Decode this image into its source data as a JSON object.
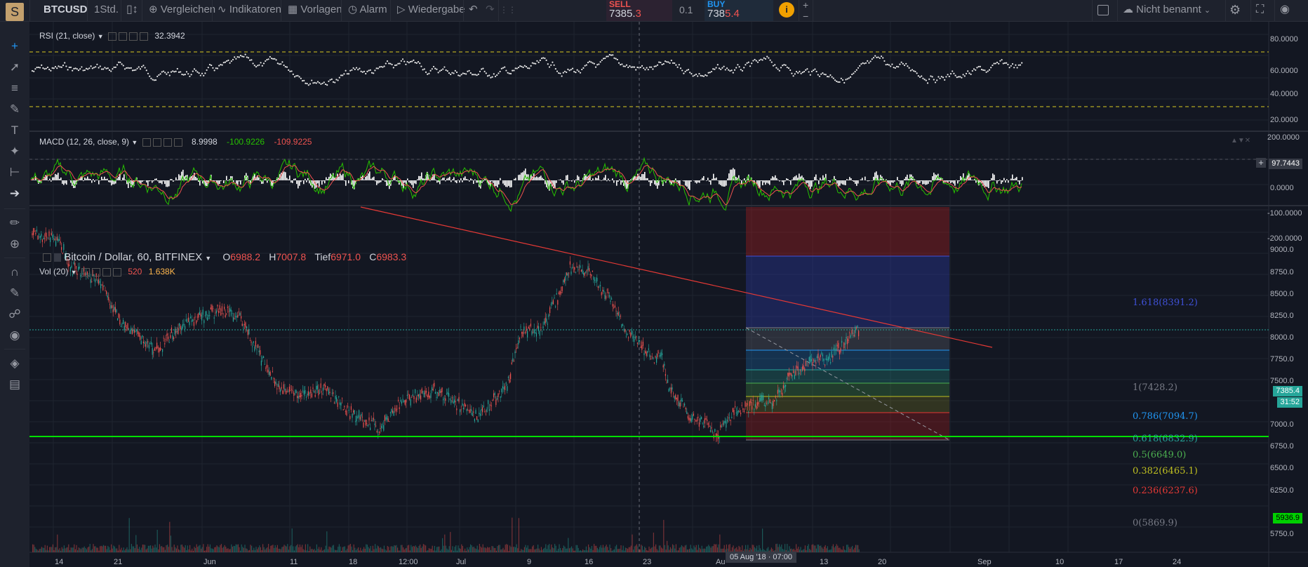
{
  "toolbar": {
    "logo": "S",
    "symbol": "BTCUSD",
    "interval": "1Std.",
    "compare": "Vergleichen",
    "indicators": "Indikatoren",
    "templates": "Vorlagen",
    "alert": "Alarm",
    "replay": "Wiedergabe",
    "sell_label": "SELL",
    "sell_price_main": "7385.",
    "sell_price_tail": "3",
    "spread": "0.1",
    "buy_label": "BUY",
    "buy_price_main": "738",
    "buy_price_tail": "5.4",
    "layout_name": "Nicht benannt",
    "plus": "+",
    "minus": "−"
  },
  "rsi": {
    "label": "RSI (21, close)",
    "value": "32.3942",
    "axis": [
      "80.0000",
      "60.0000",
      "40.0000",
      "20.0000"
    ]
  },
  "macd": {
    "label": "MACD (12, 26, close, 9)",
    "v1": "8.9998",
    "v2": "-100.9226",
    "v3": "-109.9225",
    "axis": [
      "200.0000",
      "0.0000",
      "-100.0000",
      "-200.0000"
    ],
    "tag": "97.7443"
  },
  "main": {
    "title": "Bitcoin / Dollar, 60, BITFINEX",
    "o_label": "O",
    "o": "6988.2",
    "h_label": "H",
    "h": "7007.8",
    "l_label": "Tief",
    "l": "6971.0",
    "c_label": "C",
    "c": "6983.3",
    "vol_label": "Vol (20)",
    "vol1": "520",
    "vol2": "1.638K",
    "axis": [
      "9000.0",
      "8750.0",
      "8500.0",
      "8250.0",
      "8000.0",
      "7750.0",
      "7500.0",
      "7000.0",
      "6750.0",
      "6500.0",
      "6250.0",
      "5750.0"
    ],
    "price_tag": "7385.4",
    "countdown": "31:52",
    "support_tag": "5936.9",
    "support_hidden_tick": "6000.0"
  },
  "fib": [
    {
      "label": "1.618(8391.2)",
      "color": "#3f51d8"
    },
    {
      "label": "1(7428.2)",
      "color": "#787b86"
    },
    {
      "label": "0.786(7094.7)",
      "color": "#2196f3"
    },
    {
      "label": "0.618(6832.9)",
      "color": "#26a69a"
    },
    {
      "label": "0.5(6649.0)",
      "color": "#4caf50"
    },
    {
      "label": "0.382(6465.1)",
      "color": "#c0c020"
    },
    {
      "label": "0.236(6237.6)",
      "color": "#e53935"
    },
    {
      "label": "0(5869.9)",
      "color": "#787b86"
    }
  ],
  "xaxis": [
    "14",
    "21",
    "Jun",
    "11",
    "18",
    "12:00",
    "Jul",
    "9",
    "16",
    "23",
    "Au",
    "13",
    "20",
    "Sep",
    "10",
    "17",
    "24"
  ],
  "crosshair_time": "05 Aug '18 · 07:00",
  "colors": {
    "up": "#26a69a",
    "down": "#ef5350",
    "rsi_band": "#d8c820",
    "support": "#00e000",
    "trend": "#e53935"
  }
}
